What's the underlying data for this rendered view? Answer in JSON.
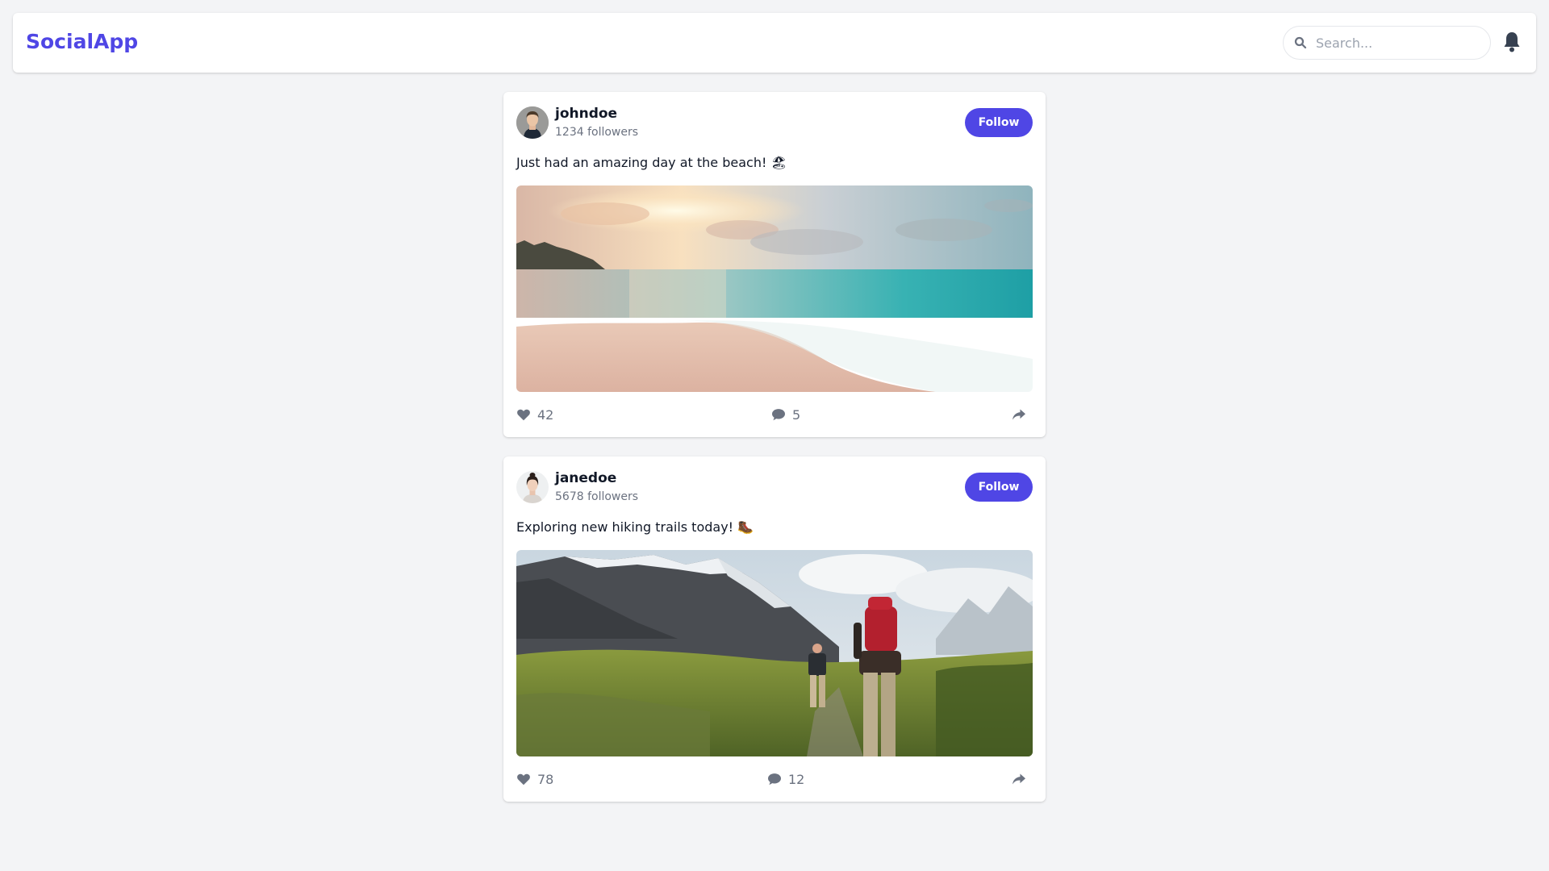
{
  "app": {
    "brand": "SocialApp",
    "accent_color": "#4f46e5"
  },
  "header": {
    "search": {
      "placeholder": "Search...",
      "value": "",
      "icon": "search-icon"
    },
    "notification_icon": "bell-icon"
  },
  "posts": [
    {
      "username": "johndoe",
      "followers": "1234 followers",
      "follow_label": "Follow",
      "text": "Just had an amazing day at the beach! 🏖",
      "image": "beach-sunset-photo",
      "likes": "42",
      "comments": "5",
      "icons": [
        "heart-icon",
        "comment-icon",
        "share-icon"
      ]
    },
    {
      "username": "janedoe",
      "followers": "5678 followers",
      "follow_label": "Follow",
      "text": "Exploring new hiking trails today! 🥾",
      "image": "mountain-hiking-photo",
      "likes": "78",
      "comments": "12",
      "icons": [
        "heart-icon",
        "comment-icon",
        "share-icon"
      ]
    }
  ]
}
